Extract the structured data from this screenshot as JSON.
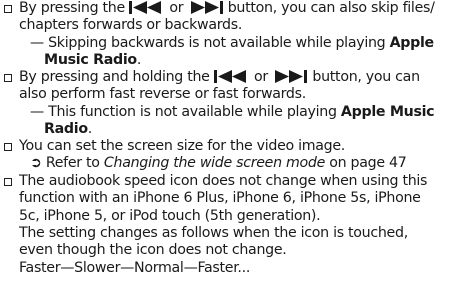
{
  "items": {
    "i1": {
      "l1a": "By pressing the",
      "l1b": "or",
      "l1c": "button, you can also skip files/",
      "l2": "chapters forwards or backwards.",
      "note1": "— Skipping backwards is not available while playing",
      "note_bold1": "Apple",
      "note_bold2": "Music Radio",
      "note_end": "."
    },
    "i2": {
      "l1a": "By pressing and holding the",
      "l1b": "or",
      "l1c": "button, you can",
      "l2": "also perform fast reverse or fast forwards.",
      "note1": "— This function is not available while playing",
      "note_bold1": "Apple Music",
      "note_bold2": "Radio",
      "note_end": "."
    },
    "i3": {
      "l1": "You can set the screen size for the video image.",
      "ref_prefix": "Refer to",
      "ref_italic": "Changing the wide screen mode",
      "ref_suffix": "on page 47"
    },
    "i4": {
      "l1": "The audiobook speed icon does not change when using this",
      "l2": "function with an iPhone 6 Plus, iPhone 6, iPhone 5s, iPhone",
      "l3": "5c, iPhone 5, or iPod touch (5th generation).",
      "l4": "The setting changes as follows when the icon is touched,",
      "l5": "even though the icon does not change.",
      "l6": "Faster—Slower—Normal—Faster..."
    }
  },
  "icons": [
    "checkbox-bullet-icon",
    "skip-back-icon",
    "skip-forward-icon",
    "reference-arrow-icon"
  ]
}
